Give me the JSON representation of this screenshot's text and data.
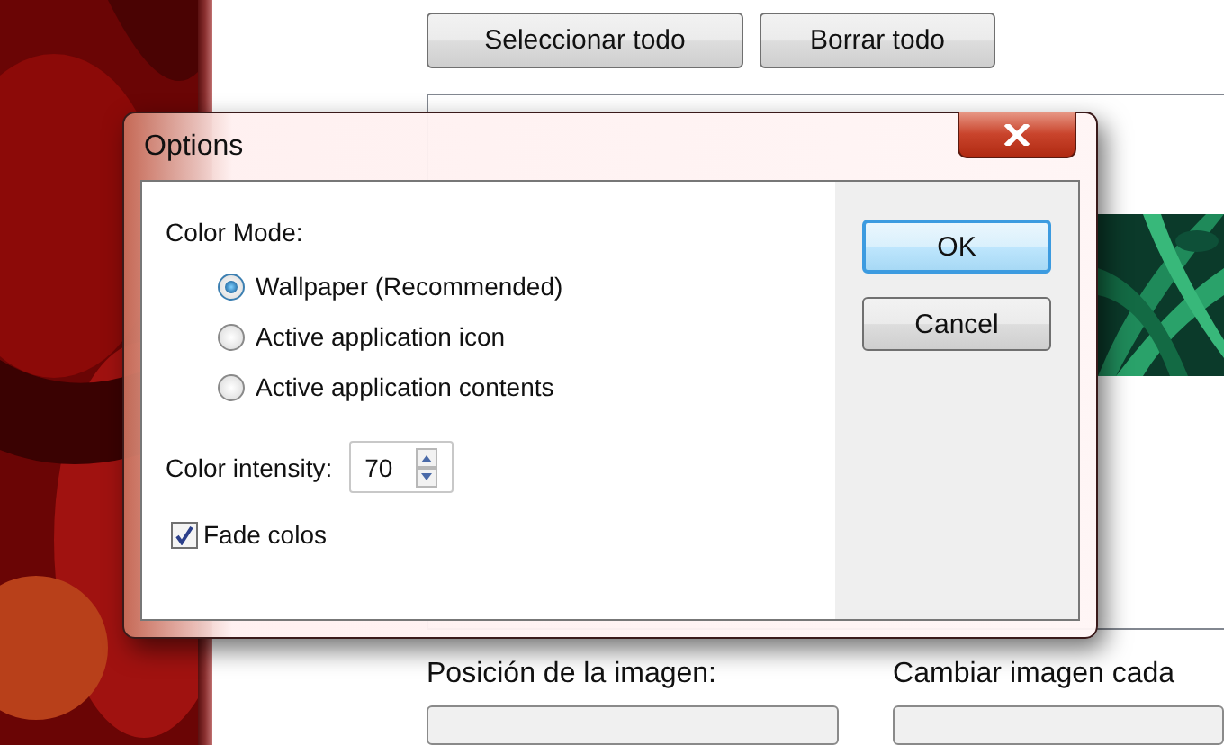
{
  "background_window": {
    "buttons": [
      "Seleccionar todo",
      "Borrar todo"
    ],
    "labels": [
      "Posición de la imagen:",
      "Cambiar imagen cada"
    ]
  },
  "dialog": {
    "title": "Options",
    "color_mode_label": "Color Mode:",
    "options": [
      {
        "label": "Wallpaper (Recommended)",
        "selected": true
      },
      {
        "label": "Active application icon",
        "selected": false
      },
      {
        "label": "Active application contents",
        "selected": false
      }
    ],
    "intensity": {
      "label": "Color intensity:",
      "value": "70"
    },
    "fade": {
      "label": "Fade colos",
      "checked": true
    },
    "buttons": [
      {
        "label": "OK",
        "default": true
      },
      {
        "label": "Cancel",
        "default": false
      }
    ]
  }
}
